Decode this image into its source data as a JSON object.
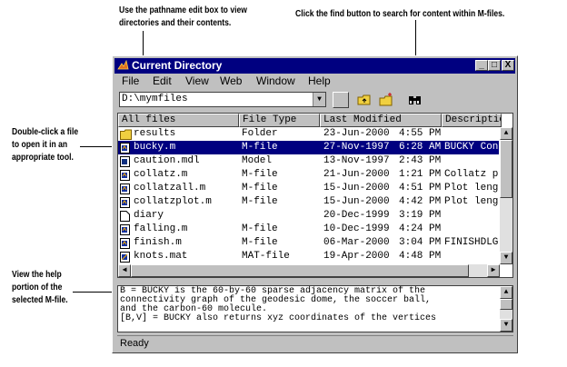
{
  "annotations": {
    "pathname": [
      "Use the pathname edit box to view",
      "directories and their contents."
    ],
    "find": [
      "Click the find button to search for content within M-files."
    ],
    "doubleclick": [
      "Double-click a file",
      "to open it in an",
      "appropriate tool."
    ],
    "help": [
      "View the help",
      "portion of the",
      "selected M-file."
    ]
  },
  "window": {
    "title": "Current Directory",
    "buttons": [
      "_",
      "□",
      "X"
    ]
  },
  "menu": [
    "File",
    "Edit",
    "View",
    "Web",
    "Window",
    "Help"
  ],
  "toolbar": {
    "path_value": "D:\\mymfiles",
    "icons": [
      "dropdown-icon",
      "blank-button-icon",
      "up-folder-icon",
      "new-folder-icon",
      "binoculars-icon"
    ]
  },
  "columns": [
    "All files",
    "File Type",
    "Last Modified",
    "Description"
  ],
  "files": [
    {
      "name": "results",
      "type": "Folder",
      "date": "23-Jun-2000",
      "time": "4:55 PM",
      "desc": "",
      "icon": "folder-icon"
    },
    {
      "name": "bucky.m",
      "type": "M-file",
      "date": "27-Nov-1997",
      "time": "6:28 AM",
      "desc": "BUCKY  Con",
      "icon": "mfile-icon",
      "selected": true
    },
    {
      "name": "caution.mdl",
      "type": "Model",
      "date": "13-Nov-1997",
      "time": "2:43 PM",
      "desc": "",
      "icon": "model-icon"
    },
    {
      "name": "collatz.m",
      "type": "M-file",
      "date": "21-Jun-2000",
      "time": "1:21 PM",
      "desc": "Collatz pro",
      "icon": "mfile-icon"
    },
    {
      "name": "collatzall.m",
      "type": "M-file",
      "date": "15-Jun-2000",
      "time": "4:51 PM",
      "desc": "Plot lengt",
      "icon": "mfile-icon"
    },
    {
      "name": "collatzplot.m",
      "type": "M-file",
      "date": "15-Jun-2000",
      "time": "4:42 PM",
      "desc": "Plot lengtl",
      "icon": "mfile-icon"
    },
    {
      "name": "diary",
      "type": "",
      "date": "20-Dec-1999",
      "time": "3:19 PM",
      "desc": "",
      "icon": "document-icon"
    },
    {
      "name": "falling.m",
      "type": "M-file",
      "date": "10-Dec-1999",
      "time": "4:24 PM",
      "desc": "",
      "icon": "mfile-icon"
    },
    {
      "name": "finish.m",
      "type": "M-file",
      "date": "06-Mar-2000",
      "time": "3:04 PM",
      "desc": "FINISHDLG",
      "icon": "mfile-icon"
    },
    {
      "name": "knots.mat",
      "type": "MAT-file",
      "date": "19-Apr-2000",
      "time": "4:48 PM",
      "desc": "",
      "icon": "matfile-icon"
    }
  ],
  "help_text": "B = BUCKY is the 60-by-60 sparse adjacency matrix of the\nconnectivity graph of the geodesic dome, the soccer ball,\nand the carbon-60 molecule.\n[B,V] = BUCKY also returns xyz coordinates of the vertices",
  "status": "Ready",
  "colors": {
    "titlebar": "#000080",
    "selection": "#000080",
    "chrome": "#c0c0c0"
  }
}
